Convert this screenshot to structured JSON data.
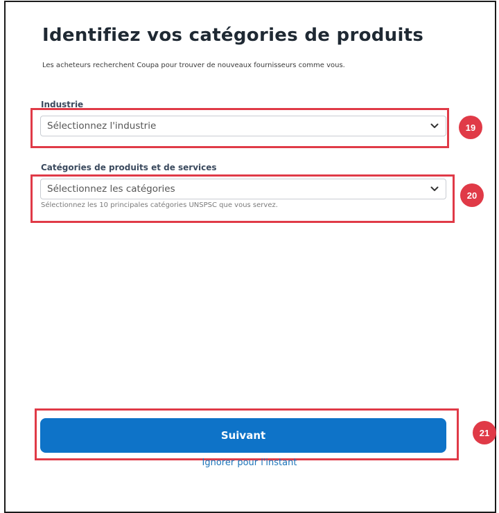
{
  "page": {
    "title": "Identifiez vos catégories de produits",
    "subtitle": "Les acheteurs recherchent Coupa pour trouver de nouveaux fournisseurs comme vous."
  },
  "industry": {
    "label": "Industrie",
    "placeholder": "Sélectionnez l'industrie",
    "icon": "chevron-down-icon"
  },
  "categories": {
    "label": "Catégories de produits et de services",
    "placeholder": "Sélectionnez les catégories",
    "hint": "Sélectionnez les 10 principales catégories UNSPSC que vous servez.",
    "icon": "chevron-down-icon"
  },
  "actions": {
    "next_label": "Suivant",
    "skip_label": "Ignorer pour l'instant"
  },
  "callouts": [
    {
      "number": "19"
    },
    {
      "number": "20"
    },
    {
      "number": "21"
    }
  ],
  "colors": {
    "primary_button": "#0e73c8",
    "link": "#1a73b8",
    "callout": "#e03a47"
  }
}
